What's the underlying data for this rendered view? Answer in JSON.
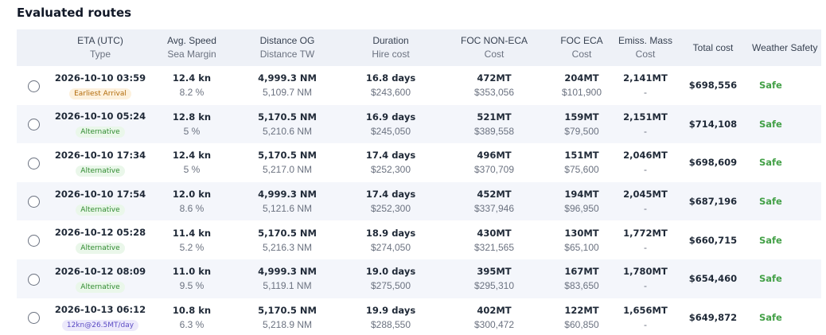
{
  "section_title": "Evaluated routes",
  "colors": {
    "safe": "#43a047",
    "header_bg": "#eef1f7",
    "row_alt_bg": "#f4f6fb"
  },
  "columns": {
    "eta": {
      "line1": "ETA (UTC)",
      "line2": "Type"
    },
    "speed": {
      "line1": "Avg. Speed",
      "line2": "Sea Margin"
    },
    "distance": {
      "line1": "Distance OG",
      "line2": "Distance TW"
    },
    "duration": {
      "line1": "Duration",
      "line2": "Hire cost"
    },
    "foc_non_eca": {
      "line1": "FOC NON-ECA",
      "line2": "Cost"
    },
    "foc_eca": {
      "line1": "FOC ECA",
      "line2": "Cost"
    },
    "emiss": {
      "line1": "Emiss. Mass",
      "line2": "Cost"
    },
    "total_cost": "Total cost",
    "weather_safety": "Weather Safety"
  },
  "rows": [
    {
      "eta": "2026-10-10 03:59",
      "type": "Earliest Arrival",
      "type_kind": "earliest",
      "speed": "12.4 kn",
      "margin": "8.2 %",
      "dist_og": "4,999.3 NM",
      "dist_tw": "5,109.7 NM",
      "duration": "16.8 days",
      "hire": "$243,600",
      "foc_non": "472MT",
      "foc_non_cost": "$353,056",
      "foc_eca": "204MT",
      "foc_eca_cost": "$101,900",
      "emiss": "2,141MT",
      "emiss_cost": "-",
      "total": "$698,556",
      "safety": "Safe"
    },
    {
      "eta": "2026-10-10 05:24",
      "type": "Alternative",
      "type_kind": "alternative",
      "speed": "12.8 kn",
      "margin": "5 %",
      "dist_og": "5,170.5 NM",
      "dist_tw": "5,210.6 NM",
      "duration": "16.9 days",
      "hire": "$245,050",
      "foc_non": "521MT",
      "foc_non_cost": "$389,558",
      "foc_eca": "159MT",
      "foc_eca_cost": "$79,500",
      "emiss": "2,151MT",
      "emiss_cost": "-",
      "total": "$714,108",
      "safety": "Safe"
    },
    {
      "eta": "2026-10-10 17:34",
      "type": "Alternative",
      "type_kind": "alternative",
      "speed": "12.4 kn",
      "margin": "5 %",
      "dist_og": "5,170.5 NM",
      "dist_tw": "5,217.0 NM",
      "duration": "17.4 days",
      "hire": "$252,300",
      "foc_non": "496MT",
      "foc_non_cost": "$370,709",
      "foc_eca": "151MT",
      "foc_eca_cost": "$75,600",
      "emiss": "2,046MT",
      "emiss_cost": "-",
      "total": "$698,609",
      "safety": "Safe"
    },
    {
      "eta": "2026-10-10 17:54",
      "type": "Alternative",
      "type_kind": "alternative",
      "speed": "12.0 kn",
      "margin": "8.6 %",
      "dist_og": "4,999.3 NM",
      "dist_tw": "5,121.6 NM",
      "duration": "17.4 days",
      "hire": "$252,300",
      "foc_non": "452MT",
      "foc_non_cost": "$337,946",
      "foc_eca": "194MT",
      "foc_eca_cost": "$96,950",
      "emiss": "2,045MT",
      "emiss_cost": "-",
      "total": "$687,196",
      "safety": "Safe"
    },
    {
      "eta": "2026-10-12 05:28",
      "type": "Alternative",
      "type_kind": "alternative",
      "speed": "11.4 kn",
      "margin": "5.2 %",
      "dist_og": "5,170.5 NM",
      "dist_tw": "5,216.3 NM",
      "duration": "18.9 days",
      "hire": "$274,050",
      "foc_non": "430MT",
      "foc_non_cost": "$321,565",
      "foc_eca": "130MT",
      "foc_eca_cost": "$65,100",
      "emiss": "1,772MT",
      "emiss_cost": "-",
      "total": "$660,715",
      "safety": "Safe"
    },
    {
      "eta": "2026-10-12 08:09",
      "type": "Alternative",
      "type_kind": "alternative",
      "speed": "11.0 kn",
      "margin": "9.5 %",
      "dist_og": "4,999.3 NM",
      "dist_tw": "5,119.1 NM",
      "duration": "19.0 days",
      "hire": "$275,500",
      "foc_non": "395MT",
      "foc_non_cost": "$295,310",
      "foc_eca": "167MT",
      "foc_eca_cost": "$83,650",
      "emiss": "1,780MT",
      "emiss_cost": "-",
      "total": "$654,460",
      "safety": "Safe"
    },
    {
      "eta": "2026-10-13 06:12",
      "type": "12kn@26.5MT/day",
      "type_kind": "special",
      "speed": "10.8 kn",
      "margin": "6.3 %",
      "dist_og": "5,170.5 NM",
      "dist_tw": "5,218.9 NM",
      "duration": "19.9 days",
      "hire": "$288,550",
      "foc_non": "402MT",
      "foc_non_cost": "$300,472",
      "foc_eca": "122MT",
      "foc_eca_cost": "$60,850",
      "emiss": "1,656MT",
      "emiss_cost": "-",
      "total": "$649,872",
      "safety": "Safe"
    }
  ]
}
